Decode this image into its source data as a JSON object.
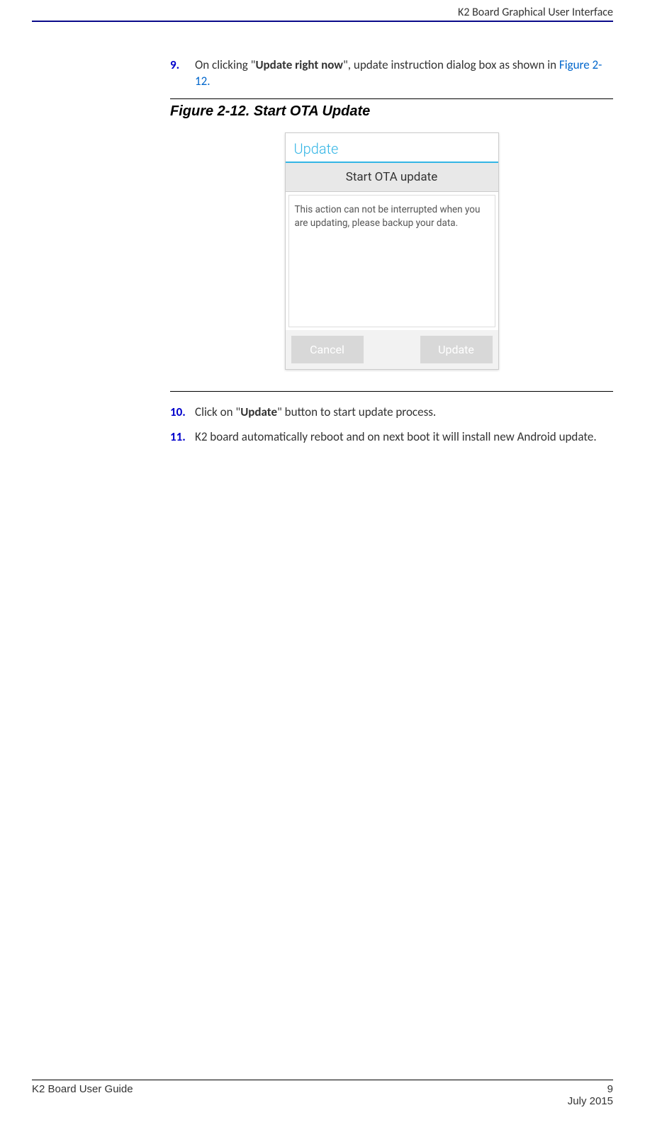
{
  "header": {
    "title": "K2 Board Graphical User Interface"
  },
  "steps": {
    "s9": {
      "num": "9.",
      "before_bold": "On clicking \"",
      "bold": "Update right now",
      "after_bold": "\", update instruction dialog box as shown in ",
      "link": "Figure 2-12.",
      "after_link": ""
    },
    "s10": {
      "num": "10.",
      "before_bold": "Click on \"",
      "bold": "Update",
      "after_bold": "\" button to start update process."
    },
    "s11": {
      "num": "11.",
      "text": "K2 board automatically reboot and on next boot it will install new Android update."
    }
  },
  "figure": {
    "caption": "Figure 2-12. Start OTA Update"
  },
  "screenshot": {
    "app_title": "Update",
    "dialog_title": "Start OTA update",
    "dialog_body": "This action can not be interrupted when you are updating, please backup your data.",
    "cancel_label": "Cancel",
    "update_label": "Update"
  },
  "footer": {
    "doc_title": "K2 Board User Guide",
    "page_num": "9",
    "date": "July 2015"
  }
}
